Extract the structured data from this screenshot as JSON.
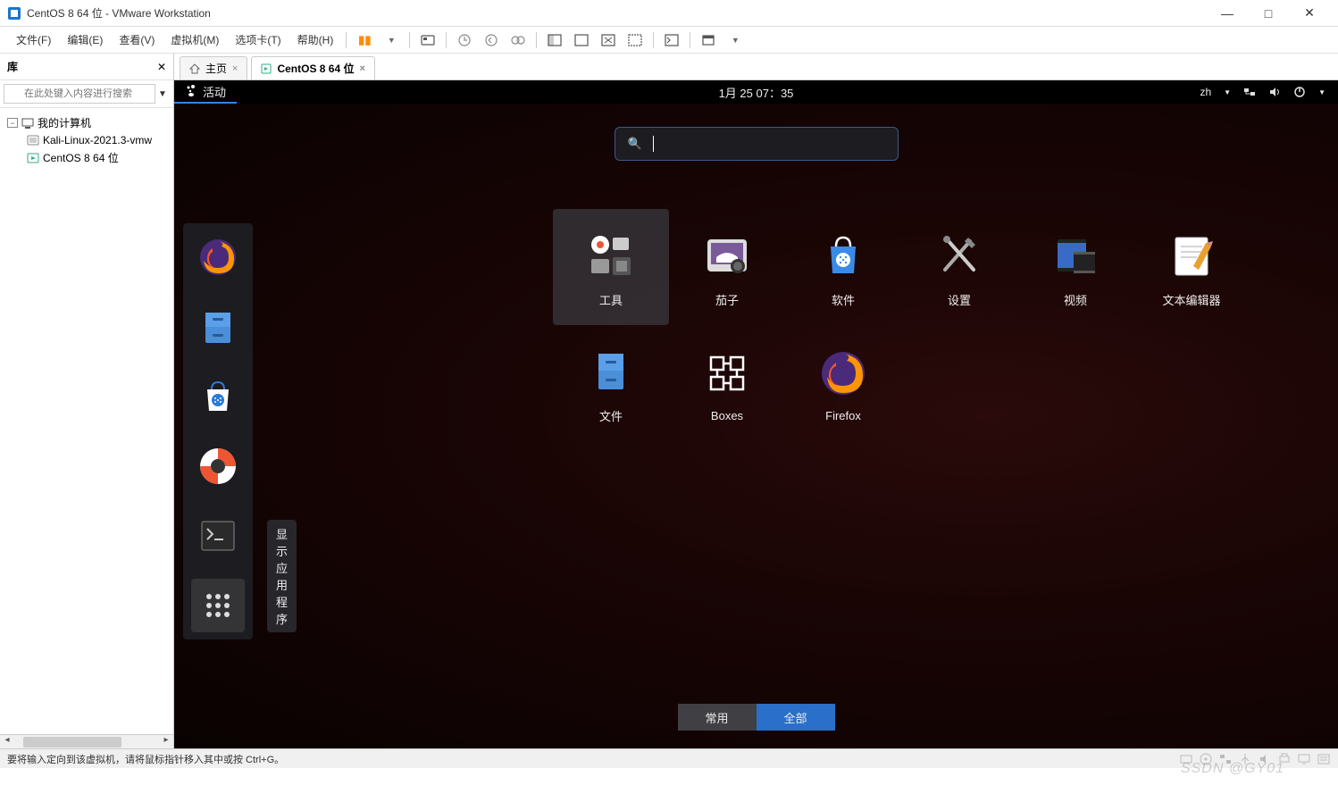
{
  "window": {
    "title": "CentOS 8 64 位 - VMware Workstation"
  },
  "menubar": {
    "file": "文件(F)",
    "edit": "编辑(E)",
    "view": "查看(V)",
    "vm": "虚拟机(M)",
    "tabs": "选项卡(T)",
    "help": "帮助(H)"
  },
  "library": {
    "header": "库",
    "search_placeholder": "在此处键入内容进行搜索",
    "root": "我的计算机",
    "items": [
      "Kali-Linux-2021.3-vmw",
      "CentOS 8 64 位"
    ]
  },
  "vmtabs": {
    "home": "主页",
    "active": "CentOS 8 64 位"
  },
  "gnome": {
    "activities": "活动",
    "datetime": "1月 25  07：35",
    "lang": "zh",
    "search_placeholder": "",
    "dock_tooltip": "显示应用程序",
    "apps_row1": [
      "工具",
      "茄子",
      "软件",
      "设置",
      "视频",
      "文本编辑器"
    ],
    "apps_row2": [
      "文件",
      "Boxes",
      "Firefox"
    ],
    "toggle_frequent": "常用",
    "toggle_all": "全部"
  },
  "statusbar": {
    "text": "要将输入定向到该虚拟机，请将鼠标指针移入其中或按 Ctrl+G。"
  },
  "watermark": "SSDN @GY01"
}
